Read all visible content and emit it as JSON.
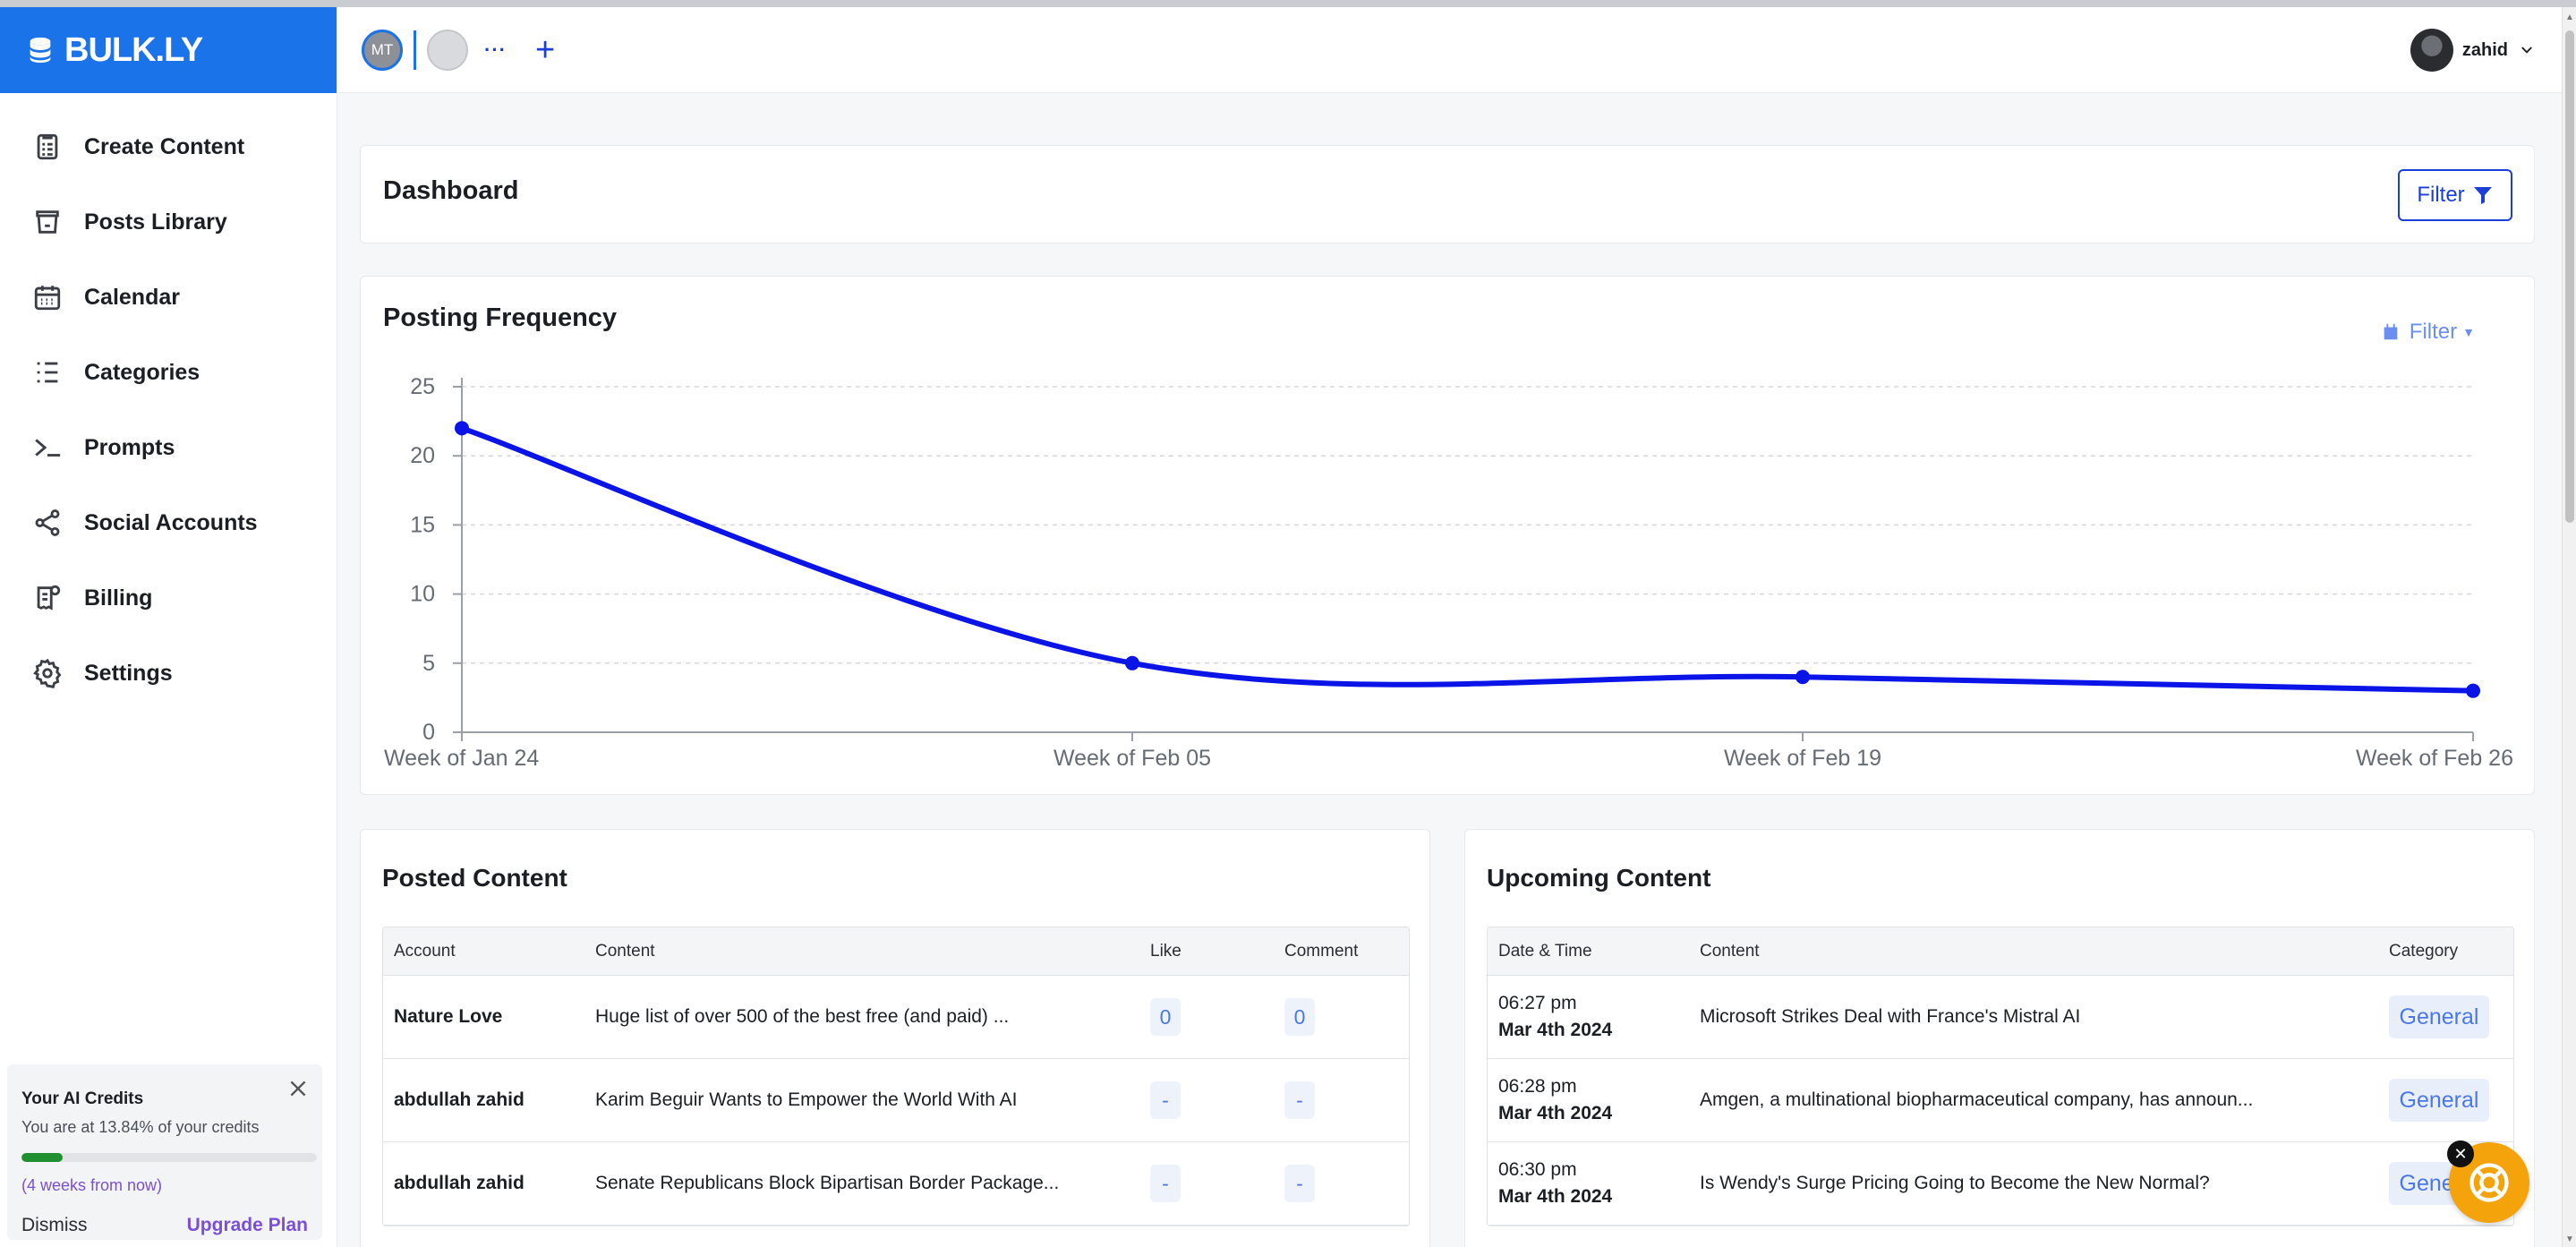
{
  "brand": {
    "name": "BULK.LY"
  },
  "sidebar": {
    "items": [
      {
        "label": "Create Content",
        "icon": "clipboard-list-icon"
      },
      {
        "label": "Posts Library",
        "icon": "archive-box-icon"
      },
      {
        "label": "Calendar",
        "icon": "calendar-icon"
      },
      {
        "label": "Categories",
        "icon": "list-icon"
      },
      {
        "label": "Prompts",
        "icon": "terminal-icon"
      },
      {
        "label": "Social Accounts",
        "icon": "share-icon"
      },
      {
        "label": "Billing",
        "icon": "receipt-icon"
      },
      {
        "label": "Settings",
        "icon": "gear-icon"
      }
    ],
    "credits": {
      "title": "Your AI Credits",
      "text": "You are at 13.84% of your credits",
      "percent": 13.84,
      "sub": "(4 weeks from now)",
      "dismiss": "Dismiss",
      "upgrade": "Upgrade Plan"
    }
  },
  "topbar": {
    "account_initials": "MT",
    "more": "···",
    "add": "+",
    "user_name": "zahid"
  },
  "dashboard": {
    "title": "Dashboard",
    "filter_label": "Filter"
  },
  "frequency": {
    "title": "Posting Frequency",
    "filter_label": "Filter"
  },
  "chart_data": {
    "type": "line",
    "title": "Posting Frequency",
    "x": [
      "Week of Jan 24",
      "Week of Feb 05",
      "Week of Feb 19",
      "Week of Feb 26"
    ],
    "series": [
      {
        "values": [
          22,
          5,
          4,
          3
        ]
      }
    ],
    "ylim": [
      0,
      25
    ],
    "yticks": [
      0,
      5,
      10,
      15,
      20,
      25
    ],
    "grid": true,
    "color": "#0a14e6"
  },
  "posted": {
    "title": "Posted Content",
    "columns": [
      "Account",
      "Content",
      "Like",
      "Comment"
    ],
    "rows": [
      {
        "account": "Nature Love",
        "content": "Huge list of over 500 of the best free (and paid) ...",
        "like": "0",
        "comment": "0"
      },
      {
        "account": "abdullah zahid",
        "content": "Karim Beguir Wants to Empower the World With AI",
        "like": "-",
        "comment": "-"
      },
      {
        "account": "abdullah zahid",
        "content": "Senate Republicans Block Bipartisan Border Package...",
        "like": "-",
        "comment": "-"
      }
    ]
  },
  "upcoming": {
    "title": "Upcoming Content",
    "columns": [
      "Date & Time",
      "Content",
      "Category"
    ],
    "rows": [
      {
        "time": "06:27 pm",
        "date": "Mar 4th 2024",
        "content": "Microsoft Strikes Deal with France's Mistral AI",
        "category": "General"
      },
      {
        "time": "06:28 pm",
        "date": "Mar 4th 2024",
        "content": "Amgen, a multinational biopharmaceutical company, has announ...",
        "category": "General"
      },
      {
        "time": "06:30 pm",
        "date": "Mar 4th 2024",
        "content": "Is Wendy's Surge Pricing Going to Become the New Normal?",
        "category": "General"
      }
    ]
  },
  "colors": {
    "brand": "#1a73e8",
    "accent": "#1a3fd6",
    "line": "#0a14e6",
    "help": "#f5a30a"
  }
}
